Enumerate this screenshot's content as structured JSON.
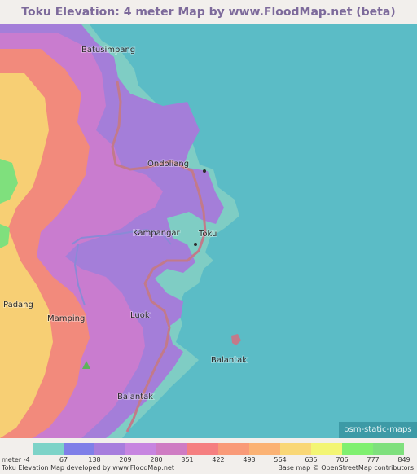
{
  "title": "Toku Elevation: 4 meter Map by www.FloodMap.net (beta)",
  "map": {
    "labels": [
      {
        "text": "Batusimpang",
        "key": "batusimpang"
      },
      {
        "text": "Ondoliang",
        "key": "ondoliang"
      },
      {
        "text": "Kampangar",
        "key": "kampangar"
      },
      {
        "text": "Toku",
        "key": "toku"
      },
      {
        "text": "Padang",
        "key": "padang"
      },
      {
        "text": "Mamping",
        "key": "mamping"
      },
      {
        "text": "Luok",
        "key": "luok"
      },
      {
        "text": "Balantak",
        "key": "balantak-island"
      },
      {
        "text": "Balantak",
        "key": "balantak"
      }
    ],
    "osm_badge": "osm-static-maps",
    "colors": {
      "sea": "#5bbcc6",
      "lowland": "#7fcdc4",
      "road": "#c27a8a"
    }
  },
  "legend": {
    "colors": [
      "#7dd3c8",
      "#7f7fe8",
      "#a77ddd",
      "#c785e0",
      "#cf7cc3",
      "#f57f80",
      "#f99a78",
      "#fbb274",
      "#f9d776",
      "#f3f574",
      "#80f070",
      "#7fe07d"
    ],
    "labels": [
      "meter -4",
      "67",
      "138",
      "209",
      "280",
      "351",
      "422",
      "493",
      "564",
      "635",
      "706",
      "777",
      "849"
    ]
  },
  "footer": {
    "left": "Toku Elevation Map developed by www.FloodMap.net",
    "right": "Base map © OpenStreetMap contributors"
  }
}
